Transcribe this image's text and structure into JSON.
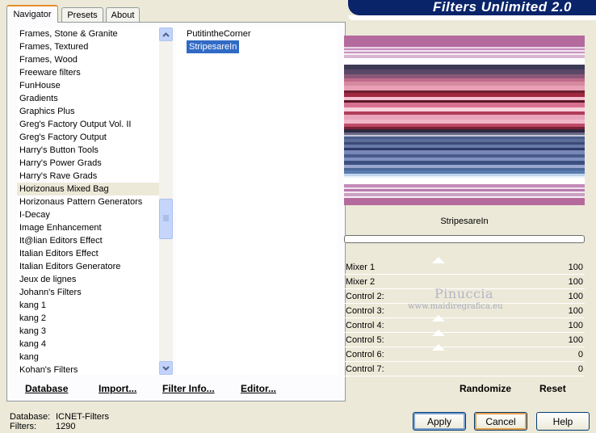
{
  "tabs": [
    "Navigator",
    "Presets",
    "About"
  ],
  "title": "Filters Unlimited 2.0",
  "categories": [
    "Frames, Stone & Granite",
    "Frames, Textured",
    "Frames, Wood",
    "Freeware filters",
    "FunHouse",
    "Gradients",
    "Graphics Plus",
    "Greg's Factory Output Vol. II",
    "Greg's Factory Output",
    "Harry's Button Tools",
    "Harry's Power Grads",
    "Harry's Rave Grads",
    "Horizonaus Mixed Bag",
    "Horizonaus Pattern Generators",
    "I-Decay",
    "Image Enhancement",
    "It@lian Editors Effect",
    "Italian Editors Effect",
    "Italian Editors Generatore",
    "Jeux de lignes",
    "Johann's Filters",
    "kang 1",
    "kang 2",
    "kang 3",
    "kang 4",
    "kang",
    "Kohan's Filters"
  ],
  "selected_category": "Horizonaus Mixed Bag",
  "filters": [
    "PutitintheCorner",
    "StripesareIn"
  ],
  "selected_filter": "StripesareIn",
  "left_buttons": {
    "database": "Database",
    "import": "Import...",
    "filter_info": "Filter Info...",
    "editor": "Editor..."
  },
  "preview_name": "StripesareIn",
  "controls": [
    {
      "label": "Mixer 1",
      "value": "100"
    },
    {
      "label": "Mixer 2",
      "value": "100"
    },
    {
      "label": "Control 2:",
      "value": "100"
    },
    {
      "label": "Control 3:",
      "value": "100"
    },
    {
      "label": "Control 4:",
      "value": "100"
    },
    {
      "label": "Control 5:",
      "value": "100"
    },
    {
      "label": "Control 6:",
      "value": "0"
    },
    {
      "label": "Control 7:",
      "value": "0"
    }
  ],
  "randomize_label": "Randomize",
  "reset_label": "Reset",
  "status": {
    "database_label": "Database:",
    "database_value": "ICNET-Filters",
    "filters_label": "Filters:",
    "filters_value": "1290"
  },
  "buttons": {
    "apply": "Apply",
    "cancel": "Cancel",
    "help": "Help"
  },
  "watermark": {
    "name": "Pinuccia",
    "site": "www.maidiregrafica.eu"
  },
  "colors": {
    "banner": "#0a246a",
    "selection": "#316ac5",
    "stripe_pink": "#b56a9e",
    "stripe_red": "#7a1f35",
    "stripe_blue": "#4a5c8c"
  }
}
